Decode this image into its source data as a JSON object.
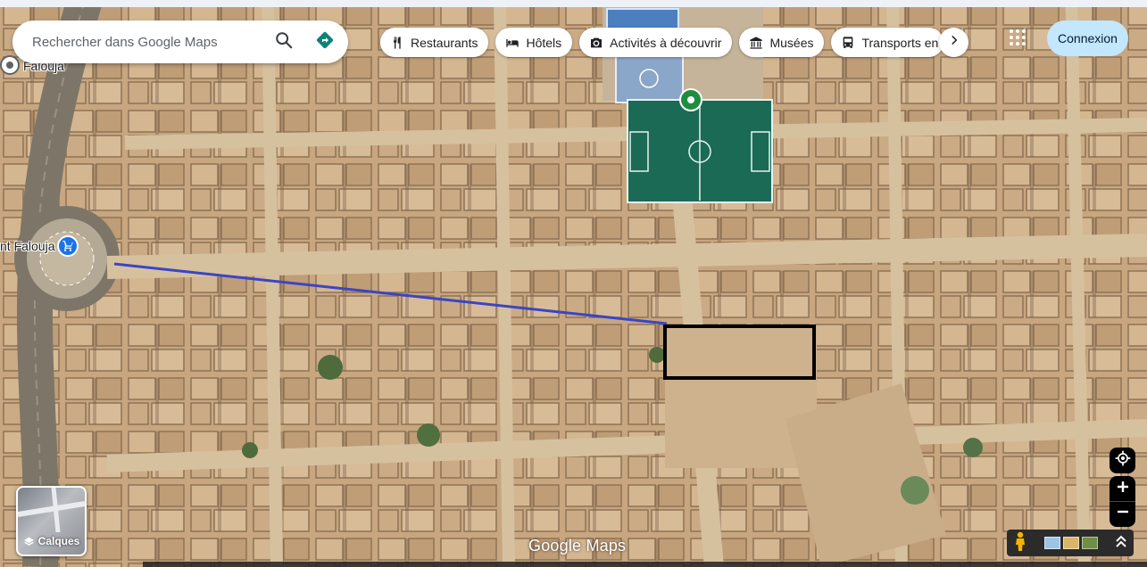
{
  "search": {
    "placeholder": "Rechercher dans Google Maps"
  },
  "categories": [
    {
      "label": "Restaurants",
      "icon": "fork-knife-icon"
    },
    {
      "label": "Hôtels",
      "icon": "bed-icon"
    },
    {
      "label": "Activités à découvrir",
      "icon": "camera-icon"
    },
    {
      "label": "Musées",
      "icon": "museum-icon"
    },
    {
      "label": "Transports en",
      "icon": "bus-icon"
    }
  ],
  "header": {
    "login_label": "Connexion"
  },
  "map": {
    "type": "satellite",
    "places": [
      {
        "label": "Falouja",
        "icon": "place-pin-icon"
      },
      {
        "label": "nt Falouja",
        "icon": "shopping-cart-icon"
      }
    ],
    "sports_pin_icon": "sports-field-pin-icon",
    "route_color": "#3b45c4",
    "highlight_color": "#000000"
  },
  "layers": {
    "label": "Calques"
  },
  "brand": {
    "label": "Google Maps"
  },
  "colors": {
    "accent": "#c2e7ff",
    "directions": "#0b8475",
    "shop_pin": "#1a73e8",
    "sport_pin": "#1e8e3e"
  }
}
